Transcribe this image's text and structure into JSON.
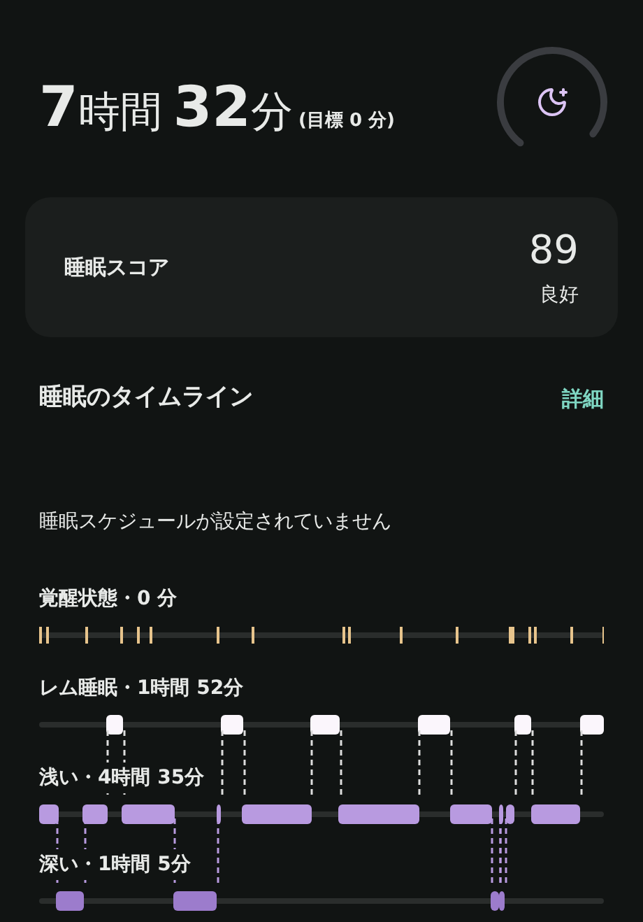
{
  "duration": {
    "hours": "7",
    "hours_unit": "時間",
    "minutes": "32",
    "minutes_unit": "分",
    "goal": "(目標 0 分)"
  },
  "score_card": {
    "label": "睡眠スコア",
    "value": "89",
    "rating": "良好"
  },
  "timeline": {
    "title": "睡眠のタイムライン",
    "details_link": "詳細",
    "notice": "睡眠スケジュールが設定されていません",
    "stages": [
      {
        "kind": "awake",
        "label": "覚醒状態・0 分"
      },
      {
        "kind": "rem",
        "label": "レム睡眠・1時間 52分"
      },
      {
        "kind": "light",
        "label": "浅い・4時間 35分"
      },
      {
        "kind": "deep",
        "label": "深い・1時間 5分"
      }
    ]
  }
}
